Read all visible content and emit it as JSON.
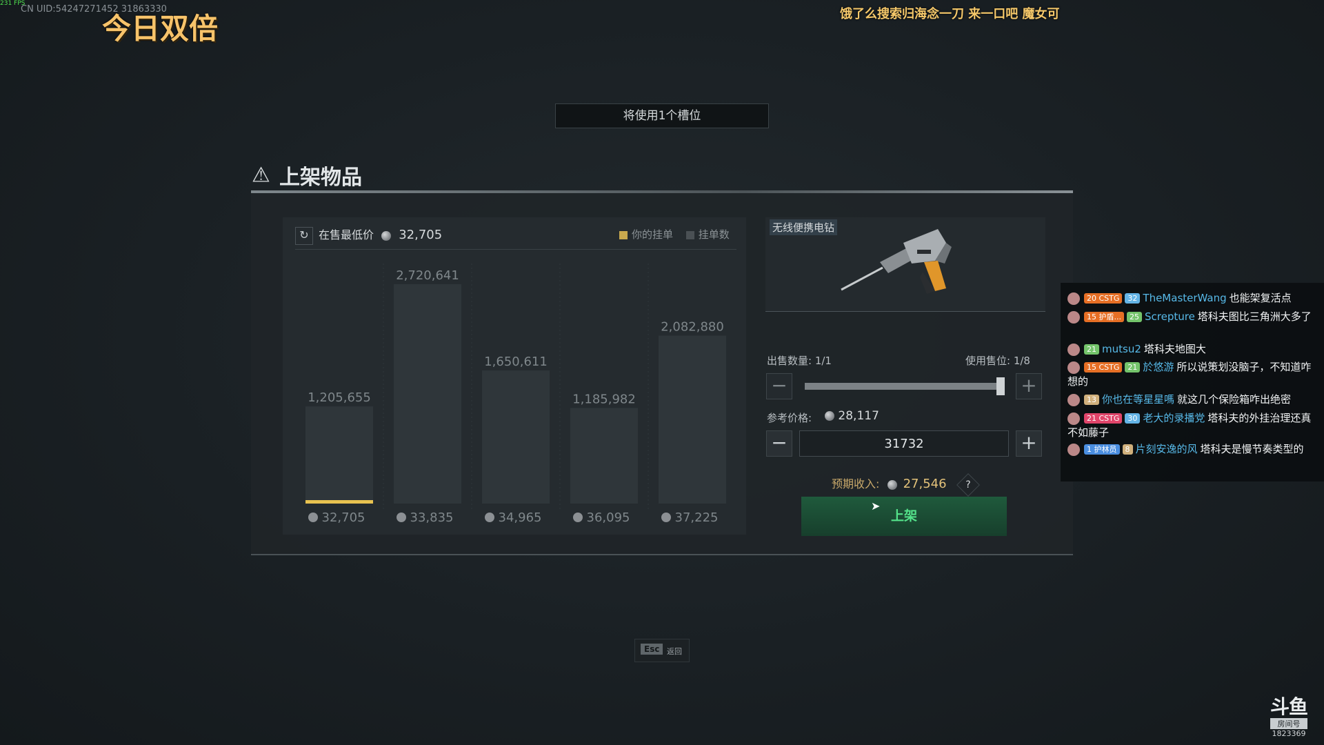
{
  "overlay": {
    "fps": "231 FPS",
    "uid": "CN UID:54247271452   31863330",
    "double_text": "今日双倍",
    "marquee": "饿了么搜索归海念一刀 来一口吧 魔女可"
  },
  "slot_banner": "将使用1个槽位",
  "dialog": {
    "title": "上架物品",
    "lowest_label": "在售最低价",
    "lowest_value": "32,705",
    "legend": {
      "yours": "你的挂单",
      "count": "挂单数",
      "yours_color": "#c9a94e",
      "count_color": "#4a5054"
    },
    "accent_color": "#e8c250"
  },
  "chart_data": {
    "type": "bar",
    "categories": [
      "32,705",
      "33,835",
      "34,965",
      "36,095",
      "37,225"
    ],
    "values": [
      1205655,
      2720641,
      1650611,
      1185982,
      2082880
    ],
    "value_labels": [
      "1,205,655",
      "2,720,641",
      "1,650,611",
      "1,185,982",
      "2,082,880"
    ],
    "highlight_index": 0,
    "ylim": [
      0,
      2720641
    ]
  },
  "item": {
    "name": "无线便携电钻",
    "qty_label": "出售数量: 1/1",
    "slots_label": "使用售位: 1/8",
    "qty_fraction": 1.0,
    "ref_label": "参考价格:",
    "ref_value": "28,117",
    "price_value": "31732",
    "income_label": "预期收入:",
    "income_value": "27,546",
    "help": "?",
    "list_button": "上架",
    "minus": "−",
    "plus": "+"
  },
  "esc": {
    "key": "Esc",
    "label": "返回"
  },
  "chat": [
    {
      "badges": [
        {
          "t": "20 CSTG",
          "c": "b-fan"
        },
        {
          "t": "32",
          "c": "b-lvl"
        }
      ],
      "user": "TheMasterWang",
      "text": "也能架复活点"
    },
    {
      "badges": [
        {
          "t": "15 护盾...",
          "c": "b-fan"
        },
        {
          "t": "25",
          "c": "b-lvl2"
        }
      ],
      "user": "Screpture",
      "text": "塔科夫图比三角洲大多了"
    },
    {
      "badges": [
        {
          "t": "21",
          "c": "b-lvl2"
        }
      ],
      "user": "mutsu2",
      "text": "塔科夫地图大"
    },
    {
      "badges": [
        {
          "t": "15 CSTG",
          "c": "b-fan"
        },
        {
          "t": "21",
          "c": "b-lvl2"
        }
      ],
      "user": "於悠游",
      "text": "所以说策划没脑子，不知道咋想的"
    },
    {
      "badges": [
        {
          "t": "13",
          "c": "b-lvl3"
        }
      ],
      "user": "你也在等星星嗎",
      "text": "就这几个保险箱咋出绝密"
    },
    {
      "badges": [
        {
          "t": "21 CSTG",
          "c": "b-cstg2"
        },
        {
          "t": "30",
          "c": "b-lvl"
        }
      ],
      "user": "老大的录播党",
      "text": "塔科夫的外挂治理还真不如藤子"
    },
    {
      "badges": [
        {
          "t": "1 护林员",
          "c": "b-guard"
        },
        {
          "t": "8",
          "c": "b-lvl3"
        }
      ],
      "user": "片刻安逸的风",
      "text": "塔科夫是慢节奏类型的"
    }
  ],
  "douyu": {
    "logo": "斗鱼",
    "sub": "房间号",
    "room": "1823369"
  }
}
